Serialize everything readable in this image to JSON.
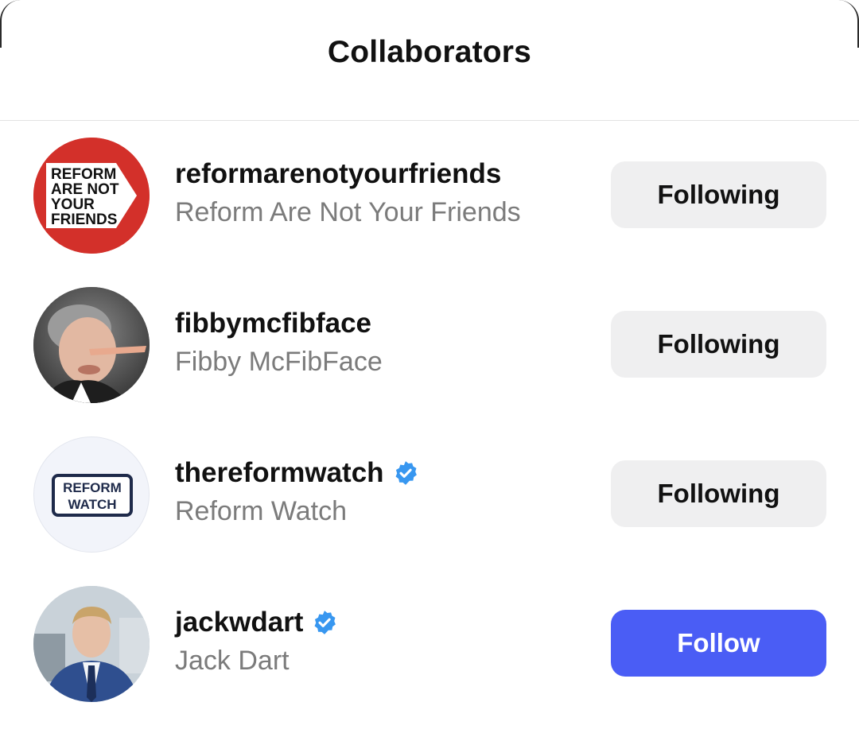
{
  "header": {
    "title": "Collaborators"
  },
  "colors": {
    "follow_button": "#4a5df5",
    "following_button": "#efeff0",
    "verified_badge": "#3897f0"
  },
  "collaborators": [
    {
      "username": "reformarenotyourfriends",
      "full_name": "Reform Are Not Your Friends",
      "verified": false,
      "button_label": "Following",
      "avatar_text": [
        "REFORM",
        "ARE NOT",
        "YOUR",
        "FRIENDS"
      ]
    },
    {
      "username": "fibbymcfibface",
      "full_name": "Fibby McFibFace",
      "verified": false,
      "button_label": "Following"
    },
    {
      "username": "thereformwatch",
      "full_name": "Reform Watch",
      "verified": true,
      "button_label": "Following",
      "avatar_text": [
        "REFORM",
        "WATCH"
      ]
    },
    {
      "username": "jackwdart",
      "full_name": "Jack Dart",
      "verified": true,
      "button_label": "Follow"
    }
  ]
}
